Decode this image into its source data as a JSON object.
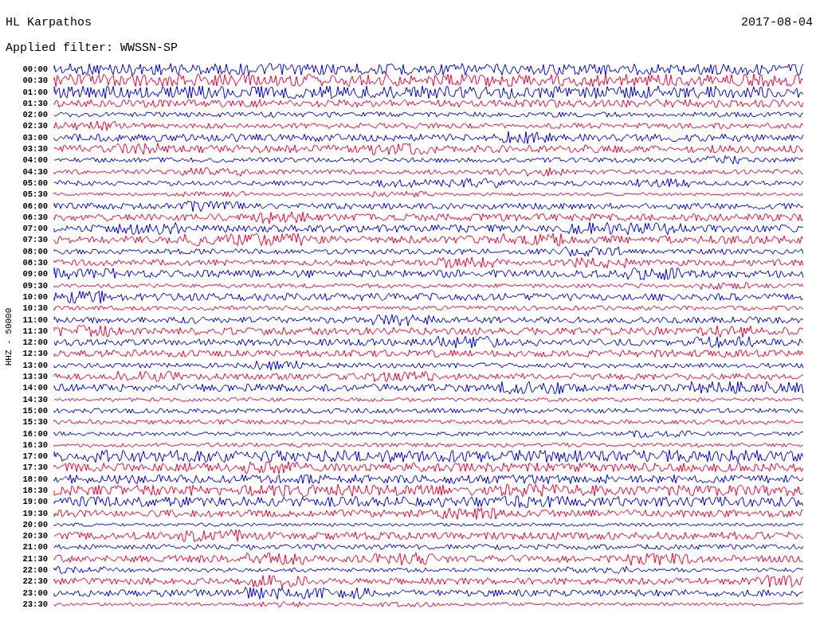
{
  "station": "HL Karpathos",
  "date": "2017-08-04",
  "filter": "Applied filter: WWSSN-SP",
  "channel_label": "HHZ - 50000",
  "traces": [
    {
      "time": "00:00",
      "color": "#0000ff"
    },
    {
      "time": "00:30",
      "color": "#ff0033"
    },
    {
      "time": "01:00",
      "color": "#0000ff"
    },
    {
      "time": "01:30",
      "color": "#ff0033"
    },
    {
      "time": "02:00",
      "color": "#0000ff"
    },
    {
      "time": "02:30",
      "color": "#ff0033"
    },
    {
      "time": "03:00",
      "color": "#0000ff"
    },
    {
      "time": "03:30",
      "color": "#ff0033"
    },
    {
      "time": "04:00",
      "color": "#0000ff"
    },
    {
      "time": "04:30",
      "color": "#ff0033"
    },
    {
      "time": "05:00",
      "color": "#0000ff"
    },
    {
      "time": "05:30",
      "color": "#ff0033"
    },
    {
      "time": "06:00",
      "color": "#0000ff"
    },
    {
      "time": "06:30",
      "color": "#ff0033"
    },
    {
      "time": "07:00",
      "color": "#0000ff"
    },
    {
      "time": "07:30",
      "color": "#ff0033"
    },
    {
      "time": "08:00",
      "color": "#0000ff"
    },
    {
      "time": "08:30",
      "color": "#ff0033"
    },
    {
      "time": "09:00",
      "color": "#0000ff"
    },
    {
      "time": "09:30",
      "color": "#ff0033"
    },
    {
      "time": "10:00",
      "color": "#0000ff"
    },
    {
      "time": "10:30",
      "color": "#ff0033"
    },
    {
      "time": "11:00",
      "color": "#0000ff"
    },
    {
      "time": "11:30",
      "color": "#ff0033"
    },
    {
      "time": "12:00",
      "color": "#0000ff"
    },
    {
      "time": "12:30",
      "color": "#ff0033"
    },
    {
      "time": "13:00",
      "color": "#0000ff"
    },
    {
      "time": "13:30",
      "color": "#ff0033"
    },
    {
      "time": "14:00",
      "color": "#0000ff"
    },
    {
      "time": "14:30",
      "color": "#ff0033"
    },
    {
      "time": "15:00",
      "color": "#0000ff"
    },
    {
      "time": "15:30",
      "color": "#ff0033"
    },
    {
      "time": "16:00",
      "color": "#0000ff"
    },
    {
      "time": "16:30",
      "color": "#ff0033"
    },
    {
      "time": "17:00",
      "color": "#0000ff"
    },
    {
      "time": "17:30",
      "color": "#ff0033"
    },
    {
      "time": "18:00",
      "color": "#0000ff"
    },
    {
      "time": "18:30",
      "color": "#ff0033"
    },
    {
      "time": "19:00",
      "color": "#0000ff"
    },
    {
      "time": "19:30",
      "color": "#ff0033"
    },
    {
      "time": "20:00",
      "color": "#0000ff"
    },
    {
      "time": "20:30",
      "color": "#ff0033"
    },
    {
      "time": "21:00",
      "color": "#0000ff"
    },
    {
      "time": "21:30",
      "color": "#ff0033"
    },
    {
      "time": "22:00",
      "color": "#0000ff"
    },
    {
      "time": "22:30",
      "color": "#ff0033"
    },
    {
      "time": "23:00",
      "color": "#0000ff"
    },
    {
      "time": "23:30",
      "color": "#ff0033"
    }
  ]
}
